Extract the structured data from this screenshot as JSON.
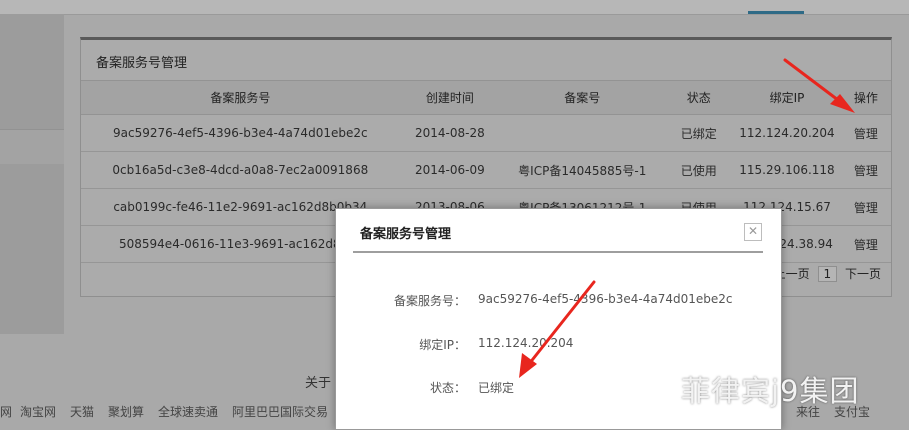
{
  "panel": {
    "title": "备案服务号管理",
    "columns": [
      "备案服务号",
      "创建时间",
      "备案号",
      "状态",
      "绑定IP",
      "操作"
    ],
    "rows": [
      {
        "service_id": "9ac59276-4ef5-4396-b3e4-4a74d01ebe2c",
        "created": "2014-08-28",
        "record_no": "",
        "status": "已绑定",
        "ip": "112.124.20.204",
        "action": "管理"
      },
      {
        "service_id": "0cb16a5d-c3e8-4dcd-a0a8-7ec2a0091868",
        "created": "2014-06-09",
        "record_no": "粤ICP备14045885号-1",
        "status": "已使用",
        "ip": "115.29.106.118",
        "action": "管理"
      },
      {
        "service_id": "cab0199c-fe46-11e2-9691-ac162d8b0b34",
        "created": "2013-08-06",
        "record_no": "粤ICP备13061212号-1",
        "status": "已使用",
        "ip": "112.124.15.67",
        "action": "管理"
      },
      {
        "service_id": "508594e4-0616-11e3-9691-ac162d8b",
        "created": "",
        "record_no": "",
        "status": "",
        "ip": "24.38.94",
        "action": "管理"
      }
    ],
    "pager": {
      "prev": "上一页",
      "current": "1",
      "next": "下一页"
    }
  },
  "modal": {
    "title": "备案服务号管理",
    "close_icon": "close-icon",
    "fields": [
      {
        "label": "备案服务号：",
        "value": "9ac59276-4ef5-4396-b3e4-4a74d01ebe2c"
      },
      {
        "label": "绑定IP：",
        "value": "112.124.20.204"
      },
      {
        "label": "状态：",
        "value": "已绑定"
      }
    ]
  },
  "footer": {
    "about": "关于",
    "links": [
      "网",
      "淘宝网",
      "天猫",
      "聚划算",
      "全球速卖通",
      "阿里巴巴国际交易",
      "来往",
      "支付宝"
    ]
  },
  "watermark": "菲律宾j9集团",
  "colors": {
    "arrow": "#e8261e",
    "accent": "#2e6a86"
  }
}
